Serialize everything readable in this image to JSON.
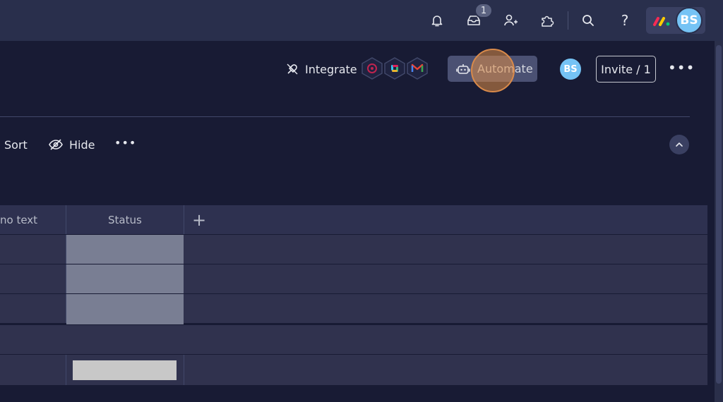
{
  "topbar": {
    "notifications_icon": "bell-icon",
    "inbox_icon": "inbox-icon",
    "inbox_badge": "1",
    "invite_members_icon": "person-plus-icon",
    "apps_icon": "puzzle-icon",
    "search_icon": "search-icon",
    "help_label": "?",
    "user_initials": "BS"
  },
  "board_header": {
    "integrate_label": "Integrate",
    "integration_icons": [
      "app-hex-icon",
      "slack-icon",
      "gmail-icon"
    ],
    "automate_label": "Automate",
    "avatar_initials": "BS",
    "invite_label": "Invite / 1"
  },
  "toolbar": {
    "sort_label": "Sort",
    "hide_label": "Hide"
  },
  "table": {
    "columns": [
      "no text",
      "Status"
    ],
    "add_column_label": "+",
    "row_count": 5
  },
  "colors": {
    "background": "#181b34",
    "topbar": "#292f4c",
    "accent_avatar": "#75c3f5",
    "status_cell": "#797e93",
    "click_highlight": "#d98a4a"
  }
}
